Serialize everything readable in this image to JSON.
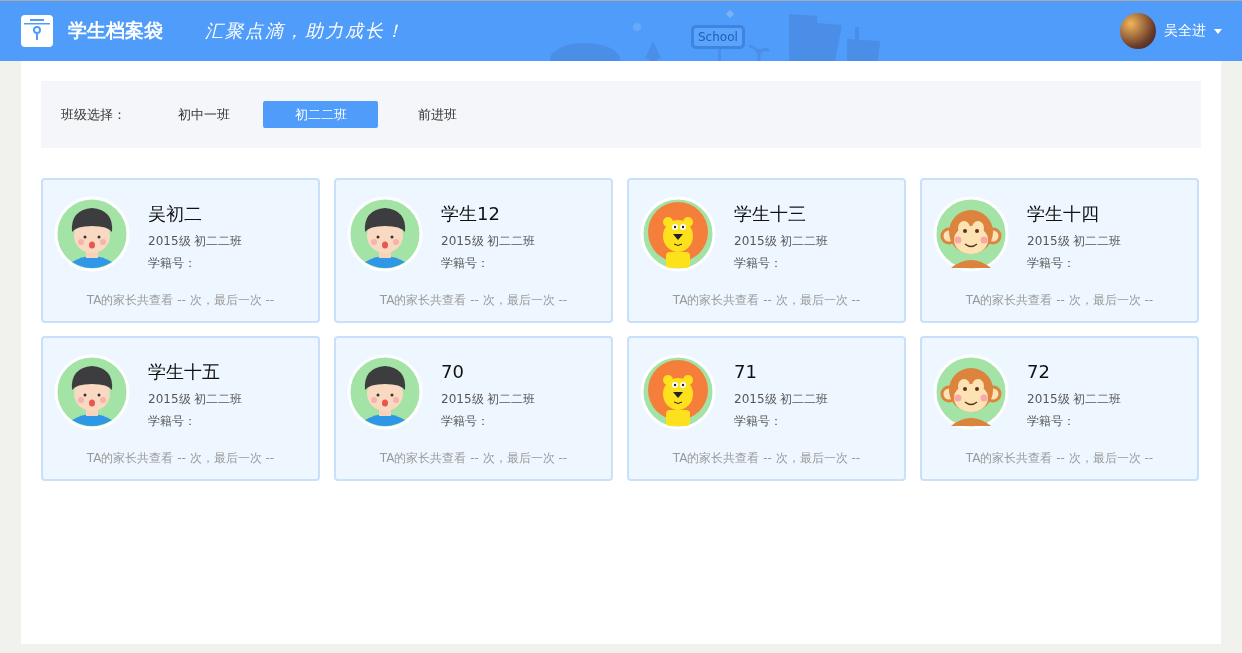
{
  "header": {
    "title": "学生档案袋",
    "slogan": "汇聚点滴，助力成长！",
    "sign": "School",
    "user": {
      "name": "吴全进"
    }
  },
  "class_filter": {
    "label": "班级选择：",
    "options": [
      {
        "label": "初中一班",
        "selected": false
      },
      {
        "label": "初二二班",
        "selected": true
      },
      {
        "label": "前进班",
        "selected": false
      }
    ]
  },
  "students": [
    {
      "name": "吴初二",
      "kind": "boy",
      "grade": "2015级 初二二班",
      "student_id": "学籍号：",
      "views": "TA的家长共查看 -- 次，最后一次 --"
    },
    {
      "name": "学生12",
      "kind": "boy",
      "grade": "2015级 初二二班",
      "student_id": "学籍号：",
      "views": "TA的家长共查看 -- 次，最后一次 --"
    },
    {
      "name": "学生十三",
      "kind": "lion",
      "grade": "2015级 初二二班",
      "student_id": "学籍号：",
      "views": "TA的家长共查看 -- 次，最后一次 --"
    },
    {
      "name": "学生十四",
      "kind": "monkey",
      "grade": "2015级 初二二班",
      "student_id": "学籍号：",
      "views": "TA的家长共查看 -- 次，最后一次 --"
    },
    {
      "name": "学生十五",
      "kind": "boy",
      "grade": "2015级 初二二班",
      "student_id": "学籍号：",
      "views": "TA的家长共查看 -- 次，最后一次 --"
    },
    {
      "name": "70",
      "kind": "boy",
      "grade": "2015级 初二二班",
      "student_id": "学籍号：",
      "views": "TA的家长共查看 -- 次，最后一次 --"
    },
    {
      "name": "71",
      "kind": "lion",
      "grade": "2015级 初二二班",
      "student_id": "学籍号：",
      "views": "TA的家长共查看 -- 次，最后一次 --"
    },
    {
      "name": "72",
      "kind": "monkey",
      "grade": "2015级 初二二班",
      "student_id": "学籍号：",
      "views": "TA的家长共查看 -- 次，最后一次 --"
    }
  ]
}
